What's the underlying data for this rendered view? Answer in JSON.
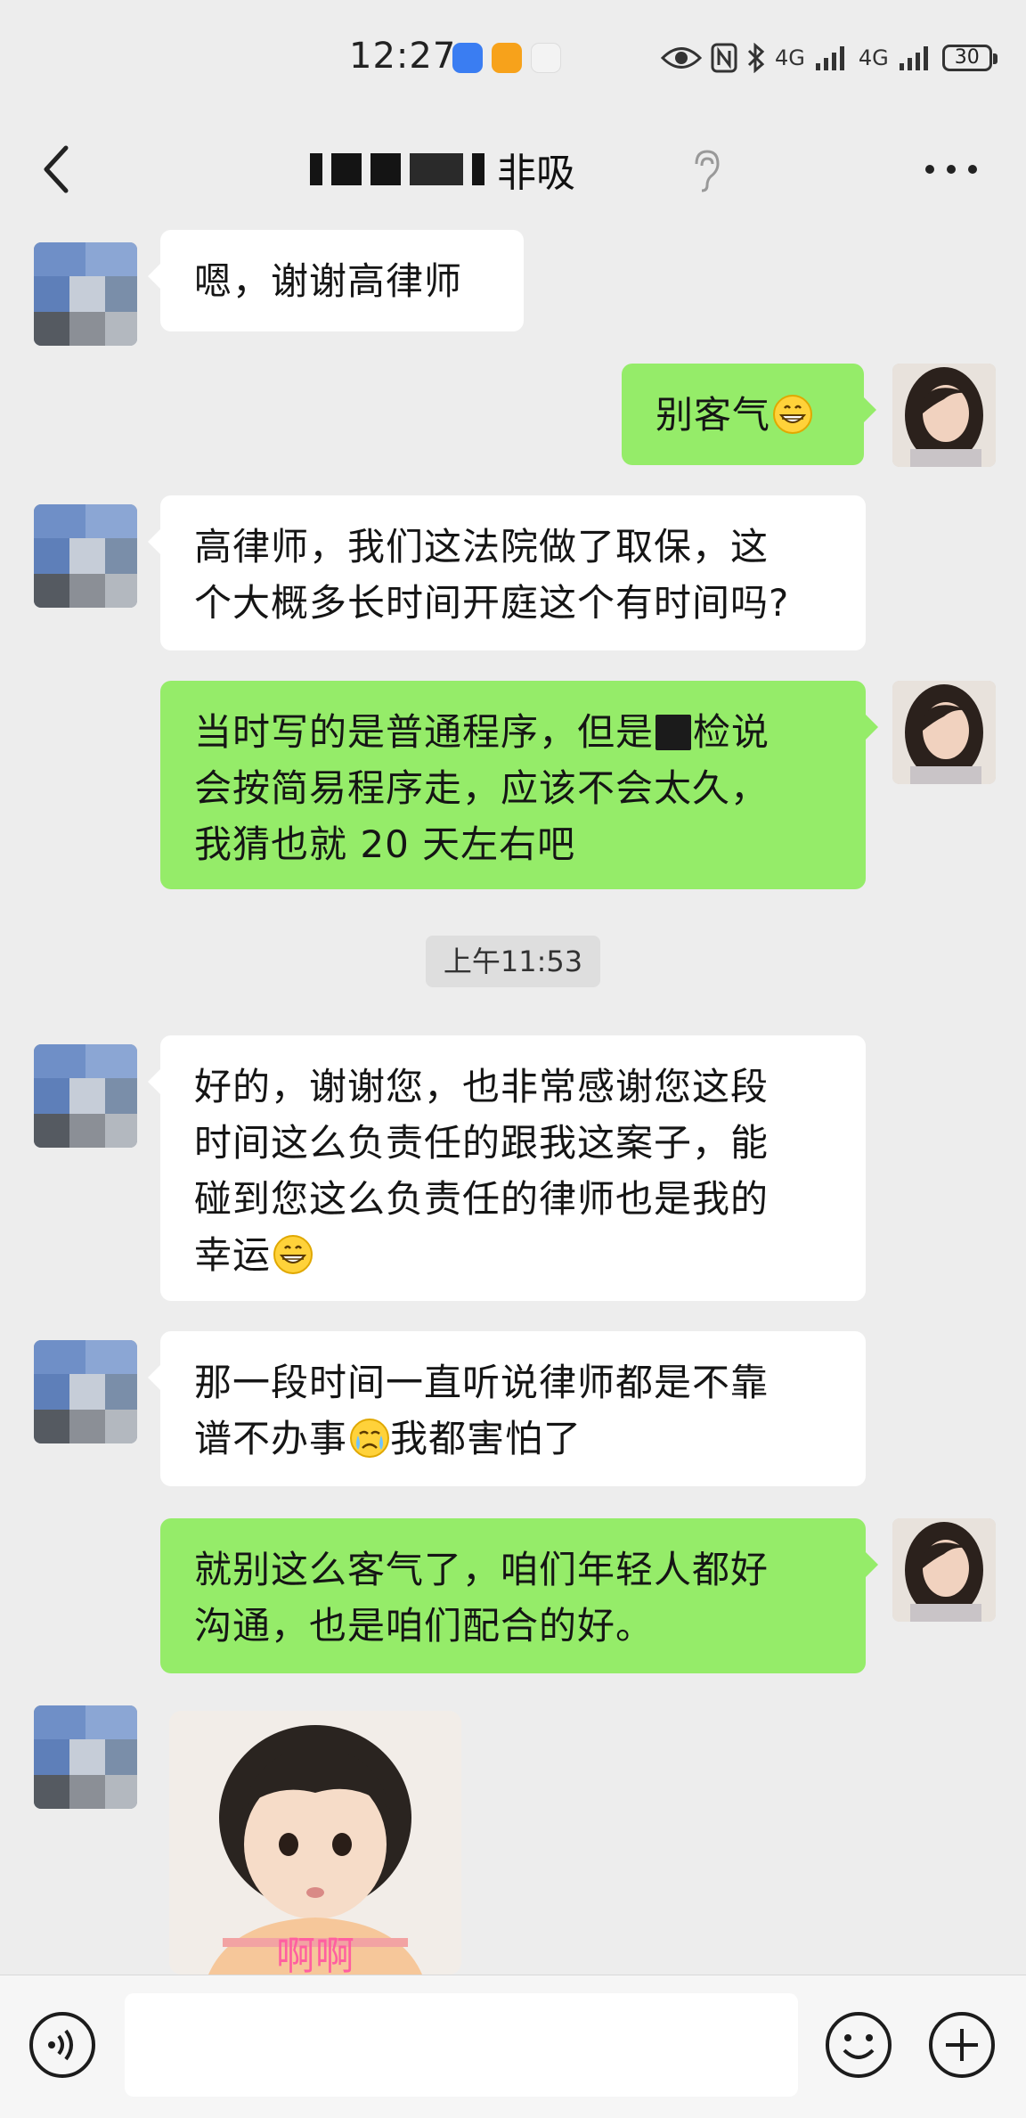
{
  "status_bar": {
    "time": "12:27",
    "battery": "30",
    "net_label_1": "4G",
    "net_label_2": "4G",
    "icons": [
      "soundwave-app-icon",
      "orange-app-icon",
      "red-app-icon",
      "eye-icon",
      "nfc-icon",
      "bluetooth-icon",
      "signal-icon",
      "signal-icon",
      "battery-icon"
    ]
  },
  "header": {
    "title_visible": "非吸",
    "icons": [
      "back-icon",
      "ear-icon",
      "more-icon"
    ]
  },
  "messages": [
    {
      "side": "left",
      "text": "嗯，谢谢高律师"
    },
    {
      "side": "right",
      "text": "别客气",
      "emoji": "grinning-face"
    },
    {
      "side": "left",
      "text": "高律师，我们这法院做了取保，这\n个大概多长时间开庭这个有时间吗?"
    },
    {
      "side": "right",
      "text_part1": "当时写的是普通程序，但是",
      "text_part2": "检说\n会按简易程序走，应该不会太久，\n我猜也就 20 天左右吧"
    },
    {
      "side": "left",
      "text": "好的，谢谢您，也非常感谢您这段\n时间这么负责任的跟我这案子，能\n碰到您这么负责任的律师也是我的\n幸运",
      "emoji": "grinning-face"
    },
    {
      "side": "left",
      "text_part1": "那一段时间一直听说律师都是不靠\n谱不办事",
      "text_part2": "我都害怕了",
      "emoji": "crying-face"
    },
    {
      "side": "right",
      "text": "就别这么客气了，咱们年轻人都好\n沟通，也是咱们配合的好。"
    },
    {
      "side": "left",
      "type": "sticker",
      "sticker_caption": "啊啊"
    }
  ],
  "timestamp": "上午11:53",
  "input_bar": {
    "placeholder": "",
    "icons": [
      "voice-icon",
      "emoji-icon",
      "plus-icon"
    ]
  },
  "colors": {
    "background": "#ededed",
    "bubble_self": "#95ec69",
    "bubble_other": "#ffffff"
  }
}
